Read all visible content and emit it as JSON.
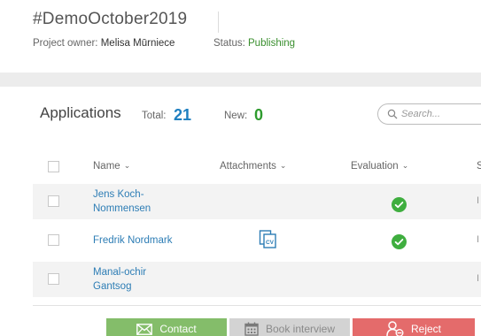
{
  "project": {
    "title": "#DemoOctober2019",
    "owner_label": "Project owner:",
    "owner_name": "Melisa Mūrniece",
    "status_label": "Status:",
    "status_value": "Publishing"
  },
  "applications": {
    "title": "Applications",
    "total_label": "Total:",
    "total_value": "21",
    "new_label": "New:",
    "new_value": "0",
    "search_placeholder": "Search..."
  },
  "table": {
    "columns": [
      {
        "label": "Name"
      },
      {
        "label": "Attachments"
      },
      {
        "label": "Evaluation"
      },
      {
        "label": "S"
      }
    ],
    "rows": [
      {
        "name": "Jens Koch-Nommensen",
        "name_line1": "Jens Koch-",
        "name_line2": "Nommensen",
        "attachment": "",
        "evaluated": true,
        "trailing": "I"
      },
      {
        "name": "Fredrik Nordmark",
        "name_line1": "Fredrik Nordmark",
        "name_line2": "",
        "attachment": "cv-document-icon",
        "evaluated": true,
        "trailing": "I"
      },
      {
        "name": "Manal-ochir Gantsog",
        "name_line1": "Manal-ochir",
        "name_line2": "Gantsog",
        "attachment": "",
        "evaluated": false,
        "trailing": "I"
      }
    ]
  },
  "actions": {
    "contact_label": "Contact",
    "book_interview_label": "Book interview",
    "reject_label": "Reject"
  },
  "colors": {
    "link": "#2d7db5",
    "status_green": "#3a8f2e",
    "total_blue": "#1e7fc0",
    "new_green": "#2e9b2e",
    "check_green": "#3fae3f",
    "contact_bg": "#84bd6a",
    "book_bg": "#d3d3d3",
    "reject_bg": "#e46b6b"
  },
  "icons": {
    "search": "search-icon",
    "evaluation": "check-circle-icon",
    "contact": "envelope-icon",
    "book": "calendar-icon",
    "reject": "user-reject-icon"
  }
}
